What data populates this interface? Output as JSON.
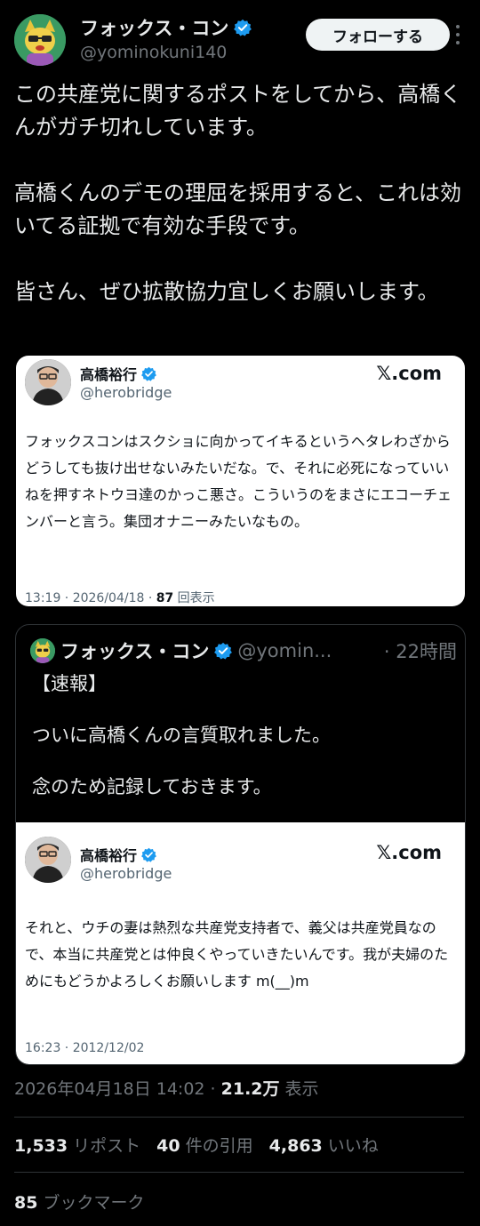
{
  "header": {
    "display_name": "フォックス・コン",
    "handle": "@yominokuni140",
    "follow_label": "フォローする"
  },
  "post": {
    "paragraphs": [
      "この共産党に関するポストをしてから、高橋くんがガチ切れしています。",
      "高橋くんのデモの理屈を採用すると、これは効いてる証拠で有効な手段です。",
      "皆さん、ぜひ拡散協力宜しくお願いします。"
    ]
  },
  "card1": {
    "name": "高橋裕行",
    "handle": "@herobridge",
    "site": "𝕏.com",
    "text": "フォックスコンはスクショに向かってイキるというヘタレわざからどうしても抜け出せないみたいだな。で、それに必死になっていいねを押すネトウヨ達のかっこ悪さ。こういうのをまさにエコーチェンバーと言う。集団オナニーみたいなもの。",
    "date": "13:19 · 2026/04/18 · ",
    "views_count": "87",
    "views_label": " 回表示"
  },
  "quote": {
    "name": "フォックス・コン",
    "handle": "@yomin...",
    "time": "· 22時間",
    "lines": [
      "【速報】",
      "ついに高橋くんの言質取れました。",
      "念のため記録しておきます。"
    ]
  },
  "card2": {
    "name": "高橋裕行",
    "handle": "@herobridge",
    "site": "𝕏.com",
    "text": "それと、ウチの妻は熱烈な共産党支持者で、義父は共産党員なので、本当に共産党とは仲良くやっていきたいんです。我が夫婦のためにもどうかよろしくお願いします m(__)m",
    "date": "16:23 · 2012/12/02"
  },
  "meta": {
    "timestamp": "2026年04月18日 14:02 · ",
    "views_count": "21.2万",
    "views_label": " 表示"
  },
  "stats": {
    "reposts_count": "1,533",
    "reposts_label": " リポスト",
    "quotes_count": "40",
    "quotes_label": " 件の引用",
    "likes_count": "4,863",
    "likes_label": " いいね",
    "bookmarks_count": "85",
    "bookmarks_label": " ブックマーク"
  },
  "colors": {
    "background": "#000000",
    "verified": "#1d9bf0",
    "muted": "#71767b"
  }
}
